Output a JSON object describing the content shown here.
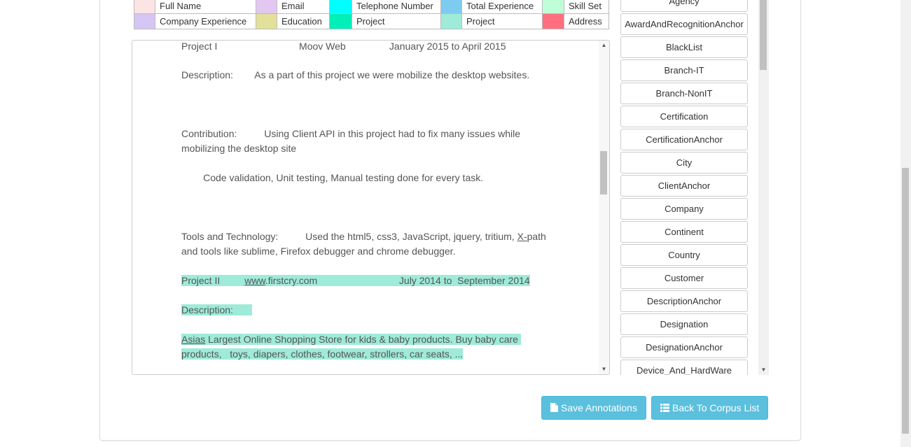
{
  "legend": {
    "rows": [
      [
        {
          "color": "#fde4e4",
          "label": "Full Name"
        },
        {
          "color": "#e2c8f0",
          "label": "Email"
        },
        {
          "color": "#00ffff",
          "label": "Telephone Number"
        },
        {
          "color": "#7ecbf0",
          "label": "Total Experience"
        },
        {
          "color": "#bfffd8",
          "label": "Skill Set"
        }
      ],
      [
        {
          "color": "#d5c6f5",
          "label": "Company Experience"
        },
        {
          "color": "#e3e09a",
          "label": "Education"
        },
        {
          "color": "#00f0b8",
          "label": "Project"
        },
        {
          "color": "#9eebd9",
          "label": "Project"
        },
        {
          "color": "#ff6f7d",
          "label": "Address"
        }
      ]
    ]
  },
  "editor": {
    "lines": {
      "l1": "Project I                              Moov Web                January 2015 to April 2015",
      "l2": "Description:        As a part of this project we were mobilize the desktop websites.",
      "l3": "Contribution:          Using Client API in this project had to fix many issues while",
      "l4": "mobilizing the desktop site",
      "l5": "        Code validation, Unit testing, Manual testing done for every task.",
      "l6a": "Tools and Technology:          Used the html5, css3, JavaScript, jquery, tritium, ",
      "l6b": "X-",
      "l6c": "path",
      "l7": "and tools like sublime, Firefox debugger and chrome debugger.",
      "l8a": "Project II         ",
      "l8b": "www",
      "l8c": ".firstcry.com                              July 2014 to  September 2014",
      "l9": "Description:       ",
      "l10a": "Asias",
      "l10b": " Largest Online Shopping Store for kids & baby products. Buy baby care ",
      "l11": "products,   toys, diapers, clothes, footwear, strollers, car seats, ..."
    }
  },
  "entities": [
    "Agency",
    "AwardAndRecognitionAnchor",
    "BlackList",
    "Branch-IT",
    "Branch-NonIT",
    "Certification",
    "CertificationAnchor",
    "City",
    "ClientAnchor",
    "Company",
    "Continent",
    "Country",
    "Customer",
    "DescriptionAnchor",
    "Designation",
    "DesignationAnchor",
    "Device_And_HardWare"
  ],
  "buttons": {
    "save": "Save Annotations",
    "back": "Back To Corpus List"
  },
  "icons": {
    "save": "file-icon",
    "back": "list-icon"
  }
}
